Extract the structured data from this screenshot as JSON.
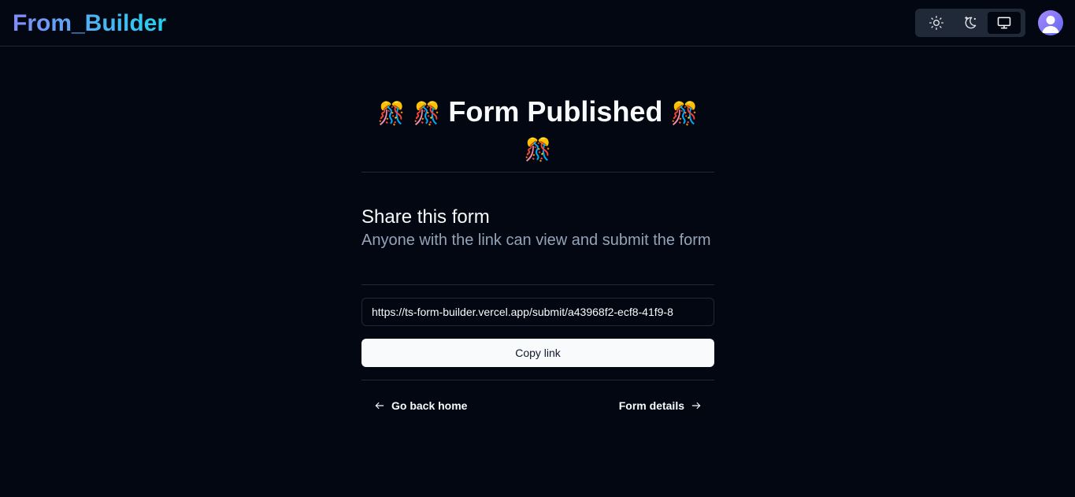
{
  "navbar": {
    "logo": "From_Builder",
    "theme": {
      "options": [
        {
          "name": "light",
          "icon": "sun-icon"
        },
        {
          "name": "dark",
          "icon": "moon-icon"
        },
        {
          "name": "system",
          "icon": "monitor-icon",
          "active": true
        }
      ]
    },
    "avatar_icon": "user-avatar"
  },
  "main": {
    "emoji": "🎊",
    "title": "Form Published",
    "share_heading": "Share this form",
    "share_description": "Anyone with the link can view and submit the form",
    "url": "https://ts-form-builder.vercel.app/submit/a43968f2-ecf8-41f9-8",
    "copy_label": "Copy link",
    "back_label": "Go back home",
    "details_label": "Form details"
  },
  "colors": {
    "background": "#030712",
    "border": "#1f2937",
    "muted_text": "#94a3b8",
    "button_bg": "#f8fafc",
    "logo_gradient_start": "#818cf8",
    "logo_gradient_end": "#22d3ee"
  }
}
